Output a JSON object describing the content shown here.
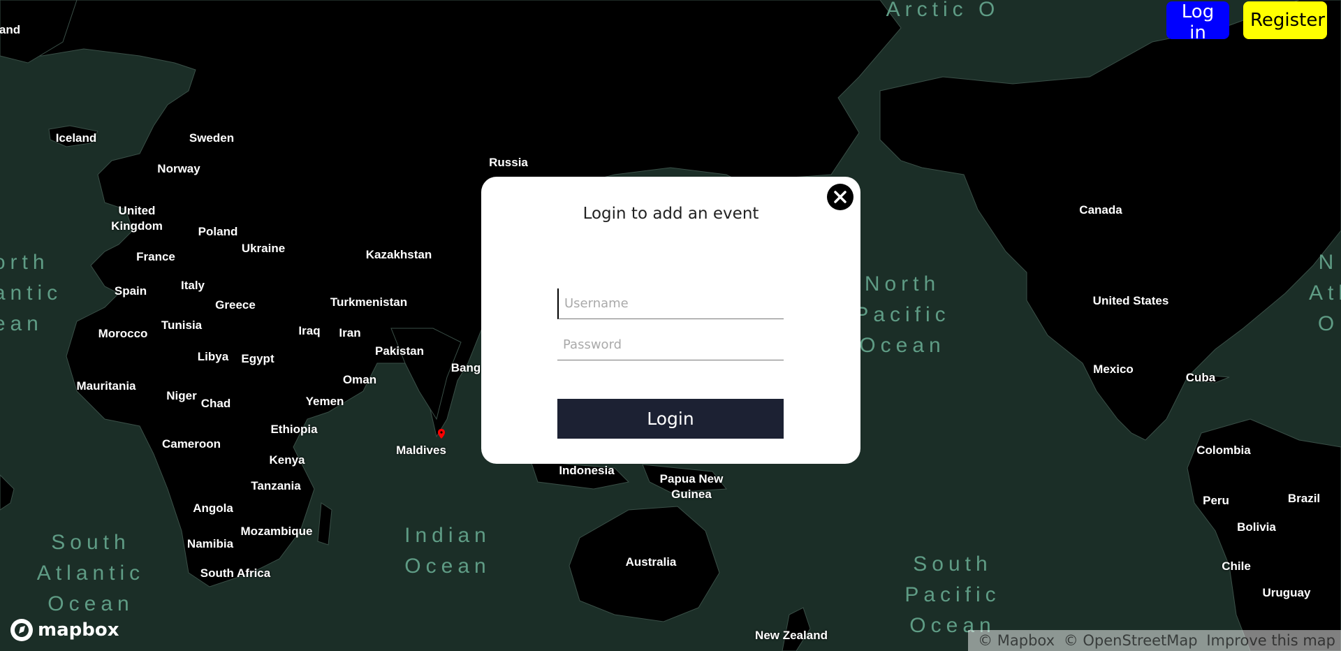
{
  "header": {
    "login_label": "Log in",
    "register_label": "Register",
    "colors": {
      "login_bg": "#0000ff",
      "register_bg": "#ffff00"
    }
  },
  "modal": {
    "title": "Login to add an event",
    "username_placeholder": "Username",
    "password_placeholder": "Password",
    "submit_label": "Login",
    "close_icon": "close-icon"
  },
  "map": {
    "countries": [
      {
        "id": "iceland",
        "label": "Iceland"
      },
      {
        "id": "sweden",
        "label": "Sweden"
      },
      {
        "id": "norway",
        "label": "Norway"
      },
      {
        "id": "united-kingdom",
        "label": "United\nKingdom"
      },
      {
        "id": "poland",
        "label": "Poland"
      },
      {
        "id": "ukraine",
        "label": "Ukraine"
      },
      {
        "id": "france",
        "label": "France"
      },
      {
        "id": "kazakhstan",
        "label": "Kazakhstan"
      },
      {
        "id": "russia",
        "label": "Russia"
      },
      {
        "id": "spain",
        "label": "Spain"
      },
      {
        "id": "italy",
        "label": "Italy"
      },
      {
        "id": "greece",
        "label": "Greece"
      },
      {
        "id": "turkmenistan",
        "label": "Turkmenistan"
      },
      {
        "id": "morocco",
        "label": "Morocco"
      },
      {
        "id": "tunisia",
        "label": "Tunisia"
      },
      {
        "id": "iraq",
        "label": "Iraq"
      },
      {
        "id": "iran",
        "label": "Iran"
      },
      {
        "id": "libya",
        "label": "Libya"
      },
      {
        "id": "egypt",
        "label": "Egypt"
      },
      {
        "id": "pakistan",
        "label": "Pakistan"
      },
      {
        "id": "bang",
        "label": "Bang"
      },
      {
        "id": "oman",
        "label": "Oman"
      },
      {
        "id": "mauritania",
        "label": "Mauritania"
      },
      {
        "id": "niger",
        "label": "Niger"
      },
      {
        "id": "chad",
        "label": "Chad"
      },
      {
        "id": "yemen",
        "label": "Yemen"
      },
      {
        "id": "ethiopia",
        "label": "Ethiopia"
      },
      {
        "id": "cameroon",
        "label": "Cameroon"
      },
      {
        "id": "kenya",
        "label": "Kenya"
      },
      {
        "id": "maldives",
        "label": "Maldives"
      },
      {
        "id": "tanzania",
        "label": "Tanzania"
      },
      {
        "id": "indonesia",
        "label": "Indonesia"
      },
      {
        "id": "papua-new-guinea",
        "label": "Papua New\nGuinea"
      },
      {
        "id": "angola",
        "label": "Angola"
      },
      {
        "id": "mozambique",
        "label": "Mozambique"
      },
      {
        "id": "namibia",
        "label": "Namibia"
      },
      {
        "id": "south-africa",
        "label": "South Africa"
      },
      {
        "id": "australia",
        "label": "Australia"
      },
      {
        "id": "new-zealand",
        "label": "New Zealand"
      },
      {
        "id": "canada",
        "label": "Canada"
      },
      {
        "id": "united-states",
        "label": "United States"
      },
      {
        "id": "mexico",
        "label": "Mexico"
      },
      {
        "id": "cuba",
        "label": "Cuba"
      },
      {
        "id": "colombia",
        "label": "Colombia"
      },
      {
        "id": "peru",
        "label": "Peru"
      },
      {
        "id": "brazil",
        "label": "Brazil"
      },
      {
        "id": "bolivia",
        "label": "Bolivia"
      },
      {
        "id": "chile",
        "label": "Chile"
      },
      {
        "id": "uruguay",
        "label": "Uruguay"
      },
      {
        "id": "and-edge",
        "label": "and"
      }
    ],
    "oceans": [
      {
        "id": "north-atlantic-left",
        "label": "orth\nantic\nean"
      },
      {
        "id": "arctic",
        "label": "Arctic O"
      },
      {
        "id": "north-pacific",
        "label": "North\nPacific\nOcean"
      },
      {
        "id": "indian",
        "label": "Indian\nOcean"
      },
      {
        "id": "south-atlantic",
        "label": "South\nAtlantic\nOcean"
      },
      {
        "id": "south-pacific",
        "label": "South\nPacific\nOcean"
      },
      {
        "id": "north-atlantic-right",
        "label": "N\nAtl\nO"
      }
    ],
    "land_color": "#000000",
    "water_color": "#1b2e27",
    "ocean_label_color": "#5f9c85",
    "marker_color": "#ff0000"
  },
  "footer": {
    "logo_text": "mapbox",
    "attribution": [
      "© Mapbox",
      "© OpenStreetMap",
      "Improve this map"
    ]
  }
}
